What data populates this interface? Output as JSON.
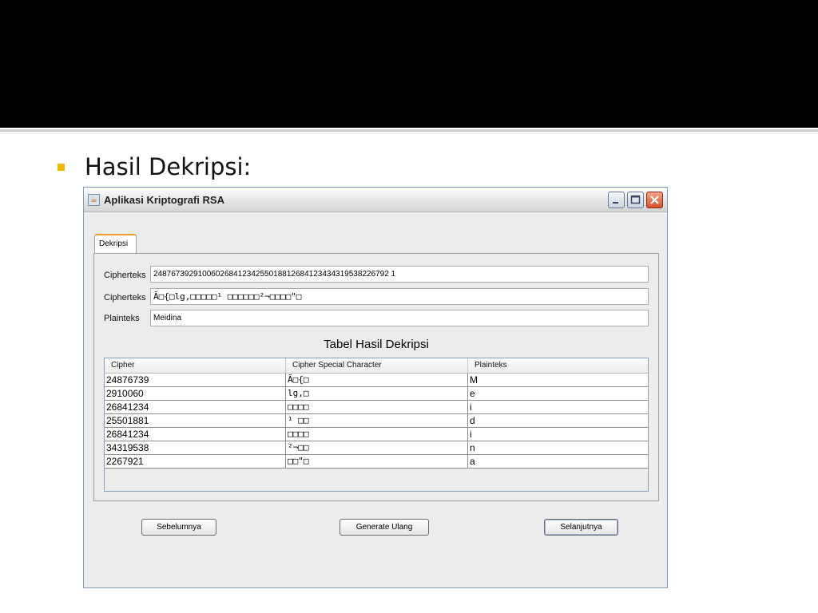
{
  "slide": {
    "title": "Hasil Dekripsi:"
  },
  "window": {
    "title": "Aplikasi Kriptografi RSA"
  },
  "tab": {
    "label": "Dekripsi"
  },
  "form": {
    "cipher_label_1": "Cipherteks",
    "cipher_value_1": "24876739291006026841234255018812684123434319538226792 1",
    "cipher_label_2": "Cipherteks",
    "cipher_value_2": "Ã□{□lg,□□□□□¹ □□□□□□²¬□□□□\"□",
    "plain_label": "Plainteks",
    "plain_value": "Meidina"
  },
  "table": {
    "title": "Tabel Hasil Dekripsi",
    "headers": [
      "Cipher",
      "Cipher Special Character",
      "Plainteks"
    ],
    "rows": [
      [
        "24876739",
        "Ã□{□",
        "M"
      ],
      [
        "2910060",
        "lg,□",
        "e"
      ],
      [
        "26841234",
        "□□□□",
        "i"
      ],
      [
        "25501881",
        "¹ □□",
        "d"
      ],
      [
        "26841234",
        "□□□□",
        "i"
      ],
      [
        "34319538",
        "²¬□□",
        "n"
      ],
      [
        "2267921",
        "□□\"□",
        "a"
      ]
    ]
  },
  "buttons": {
    "prev": "Sebelumnya",
    "regen": "Generate Ulang",
    "next": "Selanjutnya"
  },
  "colors": {
    "bullet": "#f2b800",
    "close_button": "#d9512b",
    "tab_accent": "#f0a030"
  }
}
